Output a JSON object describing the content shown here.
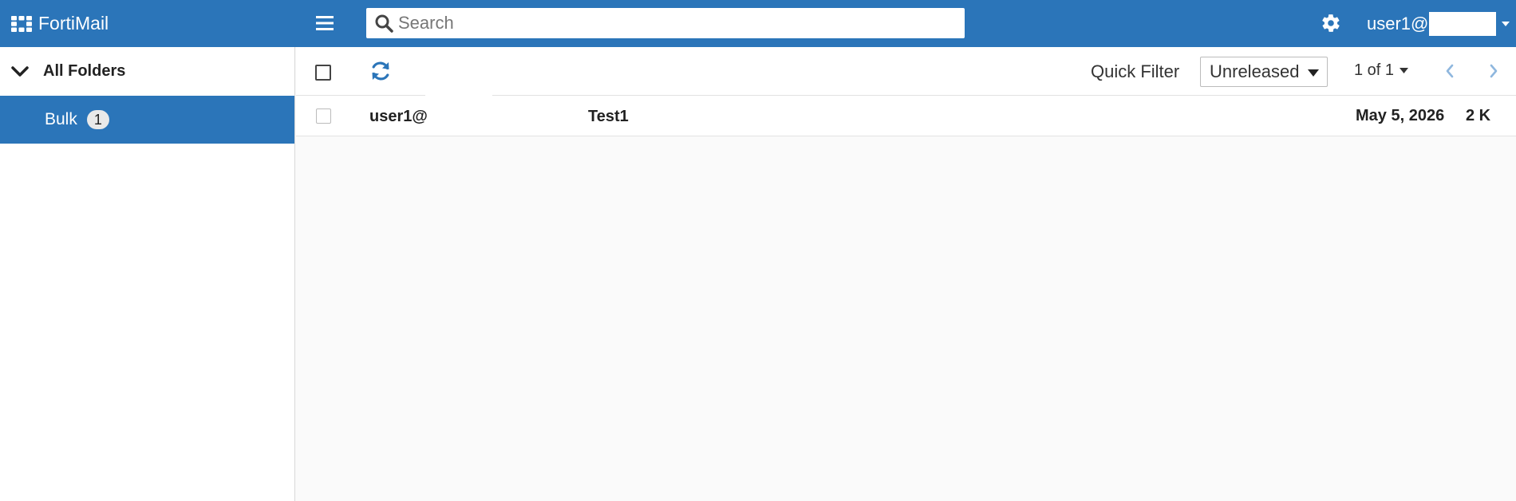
{
  "header": {
    "brand": "FortiMail",
    "search_placeholder": "Search",
    "search_value": "",
    "user": "user1@"
  },
  "sidebar": {
    "root_label": "All Folders",
    "items": [
      {
        "label": "Bulk",
        "count": "1"
      }
    ]
  },
  "toolbar": {
    "quick_filter_label": "Quick Filter",
    "quick_filter_value": "Unreleased",
    "pager": "1 of 1"
  },
  "messages": [
    {
      "sender": "user1@",
      "subject": "Test1",
      "date": "May 5, 2026",
      "size": "2 K"
    }
  ],
  "colors": {
    "header_bg": "#2b75b9",
    "selected_bg": "#2b75b9",
    "accent": "#2b75b9"
  },
  "icons": {
    "brand": "fortinet-logo-icon",
    "menu": "hamburger-icon",
    "search": "search-icon",
    "settings": "gear-icon",
    "refresh": "refresh-icon"
  }
}
